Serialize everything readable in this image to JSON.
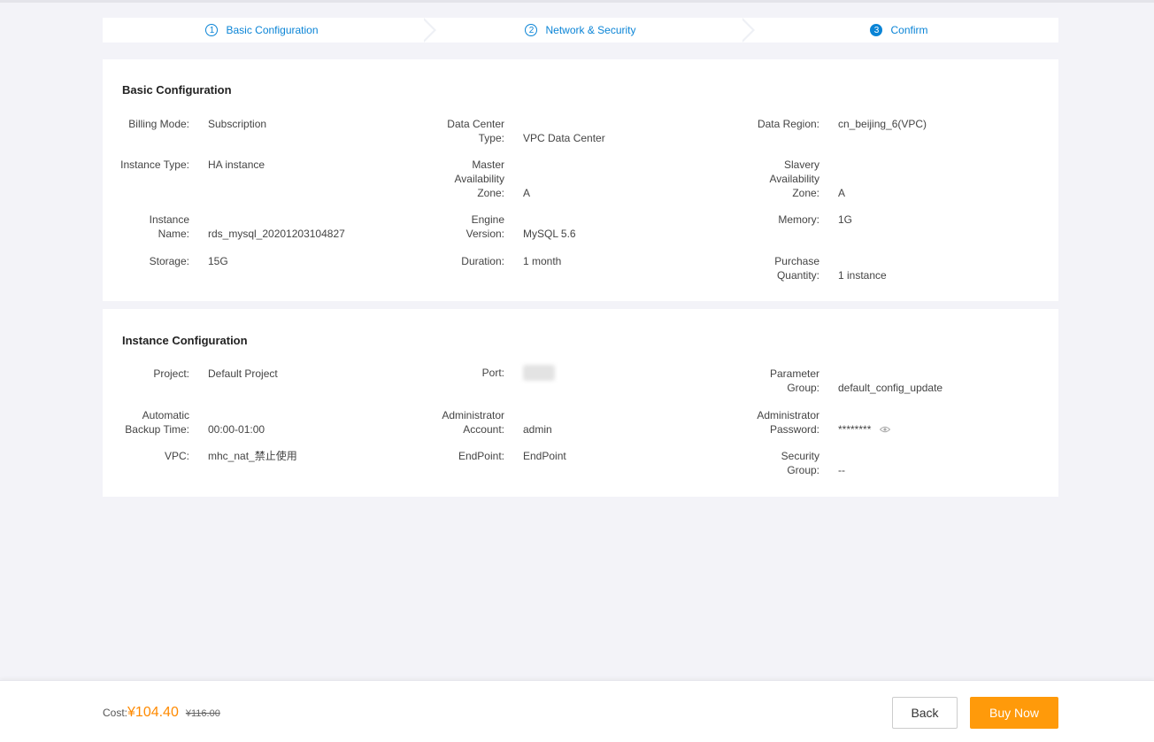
{
  "steps": [
    {
      "num": "1",
      "label": "Basic Configuration",
      "active": false
    },
    {
      "num": "2",
      "label": "Network & Security",
      "active": false
    },
    {
      "num": "3",
      "label": "Confirm",
      "active": true
    }
  ],
  "basic": {
    "title": "Basic Configuration",
    "billing_mode": {
      "label": [
        "Billing Mode:"
      ],
      "value": "Subscription"
    },
    "data_center_type": {
      "label": [
        "Data Center",
        "Type:"
      ],
      "value": "VPC Data Center"
    },
    "data_region": {
      "label": [
        "Data Region:"
      ],
      "value": "cn_beijing_6(VPC)"
    },
    "instance_type": {
      "label": [
        "Instance Type:"
      ],
      "value": "HA instance"
    },
    "master_zone": {
      "label": [
        "Master",
        "Availability",
        "Zone:"
      ],
      "value": "A"
    },
    "slavery_zone": {
      "label": [
        "Slavery",
        "Availability",
        "Zone:"
      ],
      "value": "A"
    },
    "instance_name": {
      "label": [
        "Instance",
        "Name:"
      ],
      "value": "rds_mysql_20201203104827"
    },
    "engine_version": {
      "label": [
        "Engine",
        "Version:"
      ],
      "value": "MySQL 5.6"
    },
    "memory": {
      "label": [
        "Memory:"
      ],
      "value": "1G"
    },
    "storage": {
      "label": [
        "Storage:"
      ],
      "value": "15G"
    },
    "duration": {
      "label": [
        "Duration:"
      ],
      "value": "1 month"
    },
    "purchase_quantity": {
      "label": [
        "Purchase",
        "Quantity:"
      ],
      "value": "1 instance"
    }
  },
  "instance": {
    "title": "Instance Configuration",
    "project": {
      "label": [
        "Project:"
      ],
      "value": "Default Project"
    },
    "port": {
      "label": [
        "Port:"
      ],
      "value": ""
    },
    "parameter_group": {
      "label": [
        "Parameter",
        "Group:"
      ],
      "value": "default_config_update"
    },
    "backup_time": {
      "label": [
        "Automatic",
        "Backup Time:"
      ],
      "value": "00:00-01:00"
    },
    "admin_account": {
      "label": [
        "Administrator",
        "Account:"
      ],
      "value": "admin"
    },
    "admin_password": {
      "label": [
        "Administrator",
        "Password:"
      ],
      "value": "********"
    },
    "vpc": {
      "label": [
        "VPC:"
      ],
      "value": "mhc_nat_禁止使用"
    },
    "endpoint": {
      "label": [
        "EndPoint:"
      ],
      "value": "EndPoint"
    },
    "security_group": {
      "label": [
        "Security",
        "Group:"
      ],
      "value": "--"
    }
  },
  "footer": {
    "cost_label": "Cost:",
    "price": "¥104.40",
    "original_price": "¥116.00",
    "back_label": "Back",
    "buy_label": "Buy Now"
  },
  "colors": {
    "accent": "#0a84d6",
    "price": "#ff8a00",
    "buy_button": "#ff9a0a"
  },
  "icons": {
    "password_toggle": "eye-icon"
  }
}
